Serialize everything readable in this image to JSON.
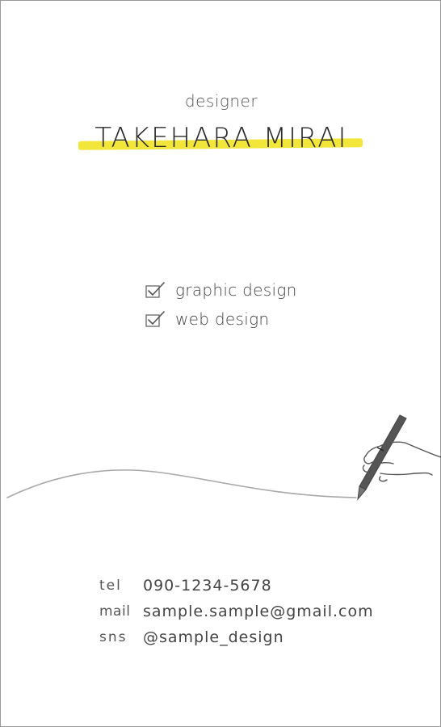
{
  "card": {
    "role": "designer",
    "name": "TAKEHARA MIRAI",
    "accent_color": "#f2e63a",
    "skills": [
      {
        "label": "graphic design",
        "icon": "checkbox-checked-icon"
      },
      {
        "label": "web design",
        "icon": "checkbox-checked-icon"
      }
    ],
    "illustration": "hand-drawing-line-with-pen",
    "contact": [
      {
        "key": "tel",
        "value": "090-1234-5678"
      },
      {
        "key": "mail",
        "value": "sample.sample@gmail.com"
      },
      {
        "key": "sns",
        "value": "@sample_design"
      }
    ]
  }
}
